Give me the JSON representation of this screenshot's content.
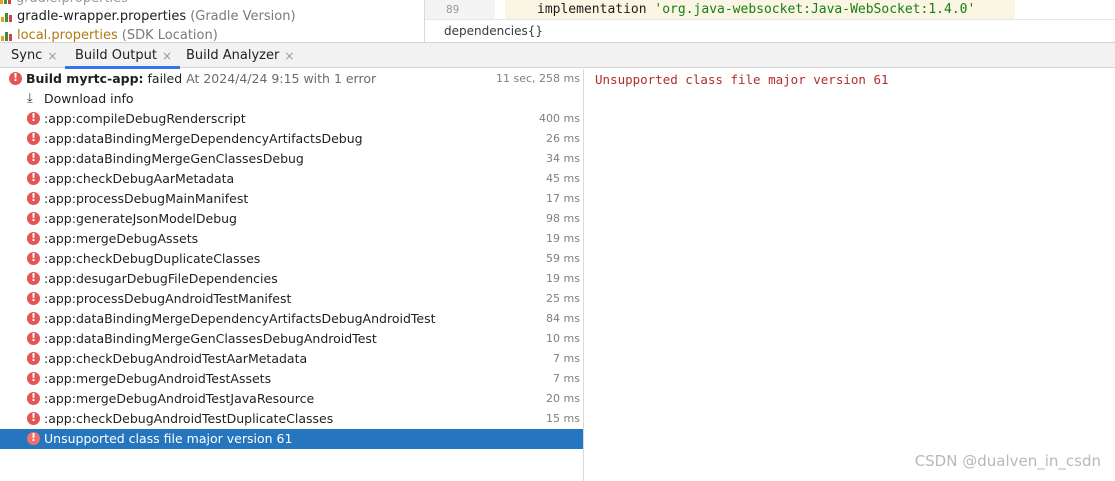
{
  "project_tree": {
    "rows": [
      {
        "name": "gradle-wrapper.properties",
        "hint": "(Gradle Version)"
      },
      {
        "name": "local.properties",
        "hint": "(SDK Location)"
      }
    ]
  },
  "editor": {
    "line_number": "89",
    "code_keyword": "implementation ",
    "code_string": "'org.java-websocket:Java-WebSocket:1.4.0'",
    "breadcrumb": "dependencies{}"
  },
  "tabs": [
    {
      "label": "Sync",
      "close": "×"
    },
    {
      "label": "Build Output",
      "close": "×"
    },
    {
      "label": "Build Analyzer",
      "close": "×"
    }
  ],
  "build": {
    "root": {
      "title": "Build myrtc-app:",
      "status": " failed",
      "detail": " At 2024/4/24 9:15 with 1 error",
      "time": "11 sec, 258 ms"
    },
    "download": {
      "label": "Download info"
    },
    "tasks": [
      {
        "label": ":app:compileDebugRenderscript",
        "time": "400 ms"
      },
      {
        "label": ":app:dataBindingMergeDependencyArtifactsDebug",
        "time": "26 ms"
      },
      {
        "label": ":app:dataBindingMergeGenClassesDebug",
        "time": "34 ms"
      },
      {
        "label": ":app:checkDebugAarMetadata",
        "time": "45 ms"
      },
      {
        "label": ":app:processDebugMainManifest",
        "time": "17 ms"
      },
      {
        "label": ":app:generateJsonModelDebug",
        "time": "98 ms"
      },
      {
        "label": ":app:mergeDebugAssets",
        "time": "19 ms"
      },
      {
        "label": ":app:checkDebugDuplicateClasses",
        "time": "59 ms"
      },
      {
        "label": ":app:desugarDebugFileDependencies",
        "time": "19 ms"
      },
      {
        "label": ":app:processDebugAndroidTestManifest",
        "time": "25 ms"
      },
      {
        "label": ":app:dataBindingMergeDependencyArtifactsDebugAndroidTest",
        "time": "84 ms"
      },
      {
        "label": ":app:dataBindingMergeGenClassesDebugAndroidTest",
        "time": "10 ms"
      },
      {
        "label": ":app:checkDebugAndroidTestAarMetadata",
        "time": "7 ms"
      },
      {
        "label": ":app:mergeDebugAndroidTestAssets",
        "time": "7 ms"
      },
      {
        "label": ":app:mergeDebugAndroidTestJavaResource",
        "time": "20 ms"
      },
      {
        "label": ":app:checkDebugAndroidTestDuplicateClasses",
        "time": "15 ms"
      }
    ],
    "error_item": {
      "label": "Unsupported class file major version 61"
    }
  },
  "console": {
    "message": "Unsupported class file major version 61"
  },
  "watermark": "CSDN @dualven_in_csdn",
  "colors": {
    "accent": "#3574f0",
    "selection": "#2675bf",
    "error": "#e25656",
    "error_text": "#b32d2d"
  }
}
